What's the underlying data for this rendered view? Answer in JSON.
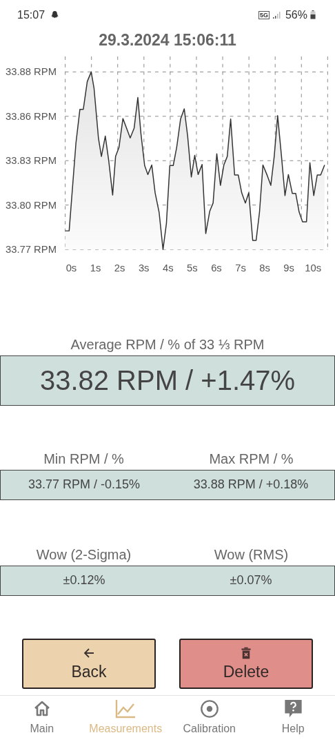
{
  "status_bar": {
    "time": "15:07",
    "network": "5G",
    "battery": "56%"
  },
  "title": "29.3.2024 15:06:11",
  "chart": {
    "chart_data": {
      "type": "area",
      "x": [
        -0.253,
        -0.09,
        0.192,
        0.354,
        0.495,
        0.658,
        0.821,
        0.94,
        1.124,
        1.243,
        1.406,
        1.547,
        1.71,
        1.829,
        1.97,
        2.133,
        2.436,
        2.599,
        2.751,
        2.881,
        3.033,
        3.163,
        3.326,
        3.466,
        3.629,
        3.792,
        3.933,
        4.074,
        4.215,
        4.356,
        4.518,
        4.67,
        4.811,
        4.963,
        5.104,
        5.245,
        5.408,
        5.559,
        5.722,
        5.863,
        6.015,
        6.167,
        6.308,
        6.449,
        6.59,
        6.752,
        6.904,
        7.045,
        7.197,
        7.338,
        7.5,
        7.641,
        7.782,
        7.923,
        8.086,
        8.249,
        8.39,
        8.531,
        8.693,
        8.834,
        8.975,
        9.138,
        9.279,
        9.42,
        9.561,
        9.724,
        9.865,
        10.027,
        10.168,
        10.309,
        10.472
      ],
      "series": [
        {
          "color": "#333333",
          "values": [
            33.784,
            33.784,
            33.8385,
            33.8593,
            33.8593,
            33.8765,
            33.8825,
            33.8722,
            33.8413,
            33.8301,
            33.8427,
            33.8273,
            33.8062,
            33.8301,
            33.8357,
            33.8536,
            33.8416,
            33.8477,
            33.8666,
            33.8441,
            33.8245,
            33.8189,
            33.8248,
            33.8076,
            33.7957,
            33.7725,
            33.7886,
            33.8245,
            33.8245,
            33.8357,
            33.8533,
            33.8596,
            33.8427,
            33.8174,
            33.8308,
            33.8189,
            33.8252,
            33.7823,
            33.7961,
            33.8013,
            33.8318,
            33.8122,
            33.8248,
            33.8301,
            33.8533,
            33.8186,
            33.8186,
            33.8076,
            33.8013,
            33.8076,
            33.7781,
            33.7781,
            33.7957,
            33.8248,
            33.8189,
            33.8122,
            33.8301,
            33.8554,
            33.8301,
            33.8059,
            33.8189,
            33.8072,
            33.8072,
            33.7957,
            33.7896,
            33.7896,
            33.8262,
            33.8059,
            33.8186,
            33.8186,
            33.8248
          ]
        }
      ],
      "xlim": [
        -0.253,
        10.6
      ],
      "ylim": [
        33.7725,
        33.8825
      ],
      "grid": true,
      "xticks": [
        {
          "value": 0,
          "label": "0s"
        },
        {
          "value": 1,
          "label": "1s"
        },
        {
          "value": 2,
          "label": "2s"
        },
        {
          "value": 3,
          "label": "3s"
        },
        {
          "value": 4,
          "label": "4s"
        },
        {
          "value": 5,
          "label": "5s"
        },
        {
          "value": 6,
          "label": "6s"
        },
        {
          "value": 7,
          "label": "7s"
        },
        {
          "value": 8,
          "label": "8s"
        },
        {
          "value": 9,
          "label": "9s"
        },
        {
          "value": 10,
          "label": "10s"
        }
      ],
      "yticks": [
        {
          "value": 33.7725,
          "label": "33.77 RPM"
        },
        {
          "value": 33.8,
          "label": "33.80 RPM"
        },
        {
          "value": 33.8275,
          "label": "33.83 RPM"
        },
        {
          "value": 33.855,
          "label": "33.86 RPM"
        },
        {
          "value": 33.8825,
          "label": "33.88 RPM"
        }
      ]
    }
  },
  "average": {
    "label": "Average RPM / % of 33 ⅓ RPM",
    "value": "33.82 RPM / +1.47%"
  },
  "stats": [
    {
      "label": "Min RPM / %",
      "value": "33.77 RPM / -0.15%"
    },
    {
      "label": "Max RPM / %",
      "value": "33.88 RPM / +0.18%"
    }
  ],
  "wow": [
    {
      "label": "Wow (2-Sigma)",
      "value": "±0.12%"
    },
    {
      "label": "Wow (RMS)",
      "value": "±0.07%"
    }
  ],
  "buttons": [
    {
      "label": "Back",
      "kind": "back"
    },
    {
      "label": "Delete",
      "kind": "delete"
    }
  ],
  "nav": [
    {
      "label": "Main",
      "kind": "home",
      "selected": false
    },
    {
      "label": "Measurements",
      "kind": "chart",
      "selected": true
    },
    {
      "label": "Calibration",
      "kind": "target",
      "selected": false
    },
    {
      "label": "Help",
      "kind": "help",
      "selected": false
    }
  ]
}
